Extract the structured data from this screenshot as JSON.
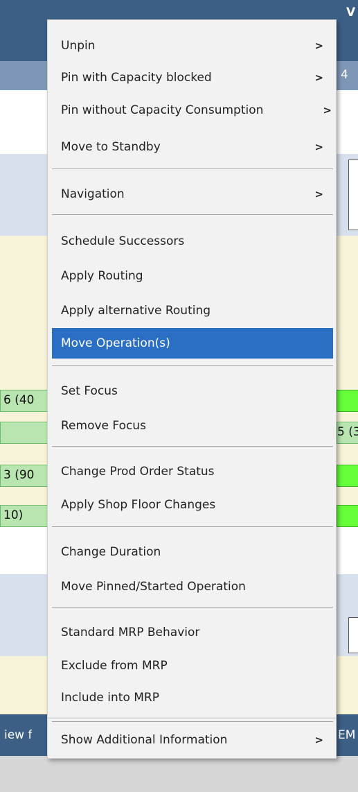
{
  "background": {
    "top_right_char": "V",
    "sub_bar_right": "4",
    "operations": [
      {
        "text": "6 (40"
      },
      {
        "text": "5 (3"
      },
      {
        "text": "3 (90"
      },
      {
        "text": "10)"
      }
    ],
    "bottom_left": "iew f",
    "bottom_right": "EM"
  },
  "context_menu": {
    "items": [
      {
        "label": "Unpin",
        "submenu": true
      },
      {
        "label": "Pin with Capacity blocked",
        "submenu": true
      },
      {
        "label": "Pin without Capacity Consumption",
        "submenu": true
      },
      {
        "label": "Move to Standby",
        "submenu": true
      },
      {
        "label": "Navigation",
        "submenu": true
      },
      {
        "label": "Schedule Successors",
        "submenu": false
      },
      {
        "label": "Apply Routing",
        "submenu": false
      },
      {
        "label": "Apply alternative Routing",
        "submenu": false
      },
      {
        "label": "Move Operation(s)",
        "submenu": false,
        "highlighted": true
      },
      {
        "label": "Set Focus",
        "submenu": false
      },
      {
        "label": "Remove Focus",
        "submenu": false
      },
      {
        "label": "Change Prod Order Status",
        "submenu": false
      },
      {
        "label": "Apply Shop Floor Changes",
        "submenu": false
      },
      {
        "label": "Change Duration",
        "submenu": false
      },
      {
        "label": "Move Pinned/Started Operation",
        "submenu": false
      },
      {
        "label": "Standard MRP Behavior",
        "submenu": false
      },
      {
        "label": "Exclude from MRP",
        "submenu": false
      },
      {
        "label": "Include into MRP",
        "submenu": false
      },
      {
        "label": "Show Additional Information",
        "submenu": true
      }
    ],
    "submenu_arrow": ">",
    "highlight_color": "#2b6fc5"
  }
}
